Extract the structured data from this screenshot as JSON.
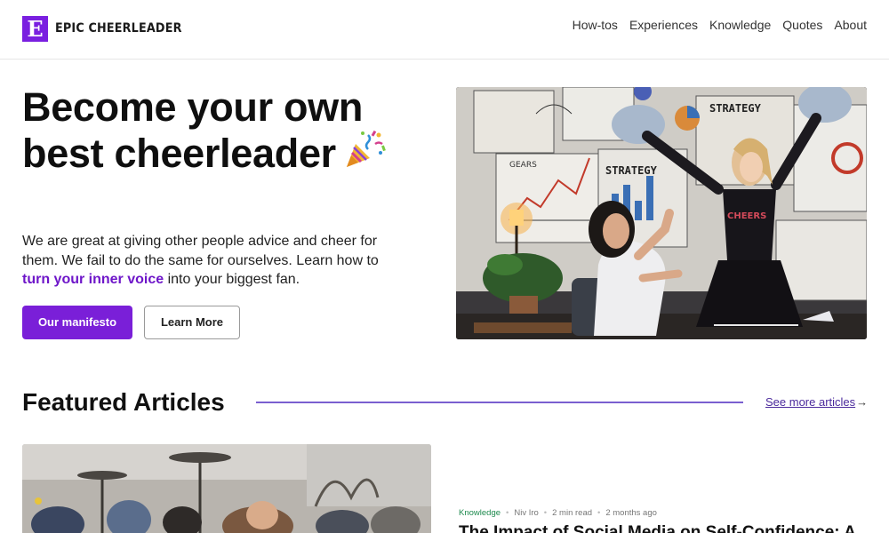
{
  "header": {
    "logo_letter": "E",
    "logo_text": "EPIC CHEERLEADER",
    "nav": [
      "How-tos",
      "Experiences",
      "Knowledge",
      "Quotes",
      "About"
    ]
  },
  "hero": {
    "title": "Become your own best cheerleader",
    "title_icon": "party-popper-icon",
    "description_before": "We are great at giving other people advice and cheer for them. We fail to do the same for ourselves. Learn how to ",
    "description_link": "turn your inner voice",
    "description_after": " into your biggest fan.",
    "primary_button": "Our manifesto",
    "secondary_button": "Learn More",
    "image_texts": {
      "board_left": "STRATEGY",
      "board_right": "STRATEGY",
      "gears": "GEARS",
      "shirt": "CHEERS"
    }
  },
  "featured": {
    "title": "Featured Articles",
    "see_more": "See more articles",
    "article": {
      "category": "Knowledge",
      "author": "Niv Iro",
      "read_time": "2 min read",
      "published": "2 months ago",
      "title": "The Impact of Social Media on Self-Confidence: A"
    }
  },
  "colors": {
    "brand": "#7a1fe0",
    "accent_text": "#6e16c9",
    "category": "#1e8a4e"
  }
}
